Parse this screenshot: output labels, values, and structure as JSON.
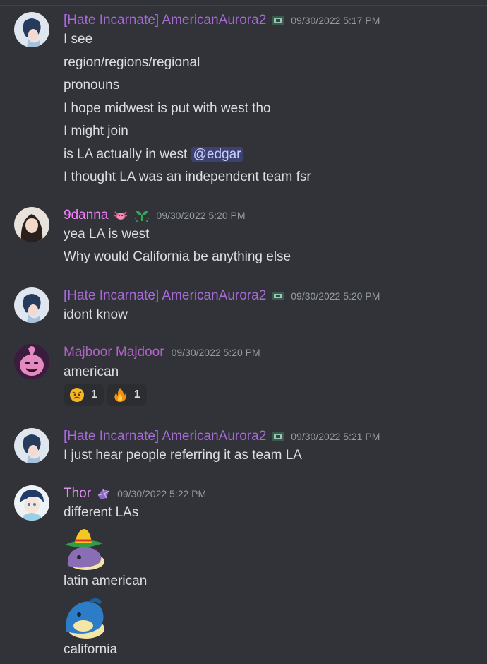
{
  "colors": {
    "background": "#313338",
    "role_purple": "#a86ad8",
    "role_pink": "#f47fff",
    "role_majboor": "#b362c8",
    "role_thor": "#e38ff0",
    "timestamp": "#949ba4",
    "mention_bg": "#3c4270"
  },
  "messages": [
    {
      "author": "[Hate Incarnate] AmericanAurora2",
      "timestamp": "09/30/2022 5:17 PM",
      "badge_icon": "server-tag-icon",
      "lines": [
        "I see",
        "region/regions/regional",
        "pronouns",
        "I hope midwest is put with west tho",
        "I might join",
        "is LA actually in west",
        "I thought LA was an independent team fsr"
      ],
      "mention": "@edgar"
    },
    {
      "author": "9danna",
      "timestamp": "09/30/2022 5:20 PM",
      "badge_icons": [
        "axolotl-icon",
        "sprout-icon"
      ],
      "lines": [
        "yea LA is west",
        "Why would California be anything else"
      ]
    },
    {
      "author": "[Hate Incarnate] AmericanAurora2",
      "timestamp": "09/30/2022 5:20 PM",
      "badge_icon": "server-tag-icon",
      "lines": [
        "idont know"
      ]
    },
    {
      "author": "Majboor Majdoor",
      "timestamp": "09/30/2022 5:20 PM",
      "lines": [
        "american"
      ],
      "reactions": [
        {
          "emoji": "angry-face-icon",
          "count": "1"
        },
        {
          "emoji": "fire-icon",
          "count": "1"
        }
      ]
    },
    {
      "author": "[Hate Incarnate] AmericanAurora2",
      "timestamp": "09/30/2022 5:21 PM",
      "badge_icon": "server-tag-icon",
      "lines": [
        "I just hear people referring it as team LA"
      ]
    },
    {
      "author": "Thor",
      "timestamp": "09/30/2022 5:22 PM",
      "badge_icon": "gem-icon",
      "lines": [
        "different LAs",
        "latin american",
        "california"
      ],
      "stickers": [
        "sombrero-dolphin-sticker",
        "blue-dolphin-sticker"
      ]
    }
  ]
}
